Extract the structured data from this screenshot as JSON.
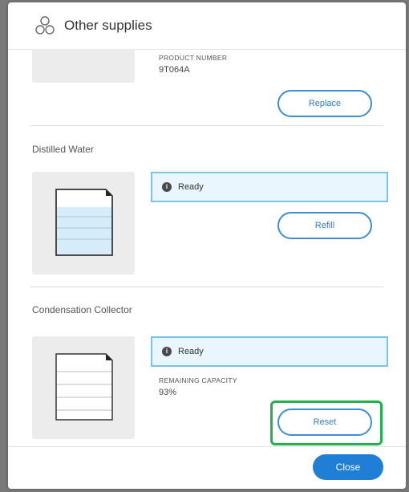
{
  "header": {
    "title": "Other supplies",
    "icon": "supplies-icon"
  },
  "sections": [
    {
      "product_label": "PRODUCT NUMBER",
      "product_value": "9T064A",
      "button_label": "Replace"
    },
    {
      "title": "Distilled Water",
      "status": "Ready",
      "button_label": "Refill"
    },
    {
      "title": "Condensation Collector",
      "status": "Ready",
      "capacity_label": "REMAINING CAPACITY",
      "capacity_value": "93%",
      "button_label": "Reset"
    }
  ],
  "footer": {
    "close_label": "Close"
  },
  "colors": {
    "accent": "#1f7ed6",
    "status_bg": "#eaf6fd",
    "status_border": "#7cc3ea",
    "highlight": "#22b14c"
  }
}
